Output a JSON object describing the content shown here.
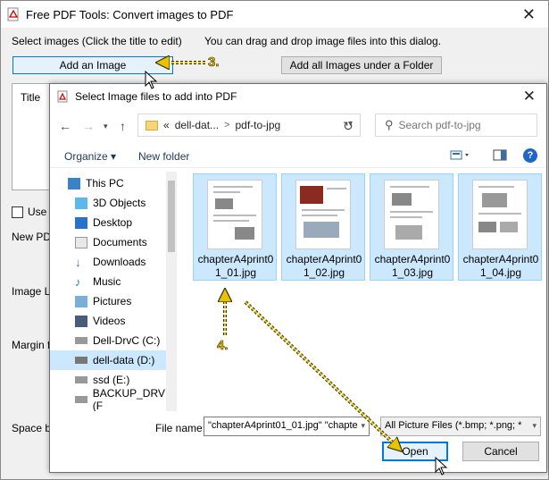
{
  "back_window": {
    "title": "Free PDF Tools: Convert images to PDF",
    "close_glyph": "✕",
    "hint_left": "Select images (Click the title to edit)",
    "hint_right": "You can drag and drop image files into this dialog.",
    "add_image_label": "Add an Image",
    "add_folder_label": "Add all Images under a Folder",
    "list_header": "Title",
    "use_label": "Use",
    "new_pd_label": "New PD",
    "image_l_label": "Image L",
    "margin_label": "Margin f",
    "space_label": "Space b"
  },
  "dialog": {
    "title": "Select Image files to add into PDF",
    "close_glyph": "✕",
    "address": {
      "prefix": "«",
      "crumb1": "dell-dat...",
      "sep": ">",
      "crumb2": "pdf-to-jpg"
    },
    "search_placeholder": "Search pdf-to-jpg",
    "toolbar": {
      "organize": "Organize ▾",
      "new_folder": "New folder",
      "help": "?"
    },
    "nav_items": [
      {
        "label": "This PC",
        "icon": "computer-icon"
      },
      {
        "label": "3D Objects",
        "icon": "cube-icon"
      },
      {
        "label": "Desktop",
        "icon": "desktop-icon"
      },
      {
        "label": "Documents",
        "icon": "documents-icon"
      },
      {
        "label": "Downloads",
        "icon": "download-icon"
      },
      {
        "label": "Music",
        "icon": "music-icon"
      },
      {
        "label": "Pictures",
        "icon": "pictures-icon"
      },
      {
        "label": "Videos",
        "icon": "video-icon"
      },
      {
        "label": "Dell-DrvC (C:)",
        "icon": "drive-icon"
      },
      {
        "label": "dell-data (D:)",
        "icon": "drive-icon"
      },
      {
        "label": "ssd (E:)",
        "icon": "drive-icon"
      },
      {
        "label": "BACKUP_DRV (F",
        "icon": "drive-icon"
      }
    ],
    "files": [
      {
        "name": "chapterA4print01_01.jpg"
      },
      {
        "name": "chapterA4print01_02.jpg"
      },
      {
        "name": "chapterA4print01_03.jpg"
      },
      {
        "name": "chapterA4print01_04.jpg"
      }
    ],
    "file_name_label": "File name:",
    "file_name_value": "\"chapterA4print01_01.jpg\" \"chapte",
    "file_type_value": "All Picture Files (*.bmp; *.png; *",
    "open_label": "Open",
    "cancel_label": "Cancel"
  },
  "annotations": {
    "step3": "3.",
    "step4": "4."
  },
  "colors": {
    "selection": "#cce8ff",
    "accent": "#0078d7",
    "callout": "#e8c300"
  }
}
